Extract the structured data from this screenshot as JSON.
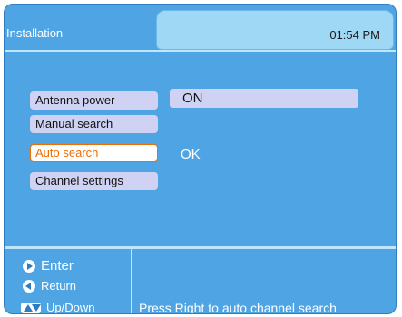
{
  "header": {
    "title": "Installation",
    "clock": "01:54 PM"
  },
  "menu": {
    "items": [
      {
        "label": "Antenna power"
      },
      {
        "label": "Manual search"
      },
      {
        "label": "Auto search"
      },
      {
        "label": "Channel settings"
      }
    ],
    "selected": "Auto search"
  },
  "values": {
    "antenna_power": "ON",
    "auto_search": "OK"
  },
  "help": {
    "enter": "Enter",
    "return": "Return",
    "updown": "Up/Down"
  },
  "status_message": "Press Right to auto channel search",
  "colors": {
    "background": "#4fa5e3",
    "item_bg": "#cfd2f2",
    "selected_border": "#f06d00",
    "clock_tab": "#9fd8f5"
  }
}
